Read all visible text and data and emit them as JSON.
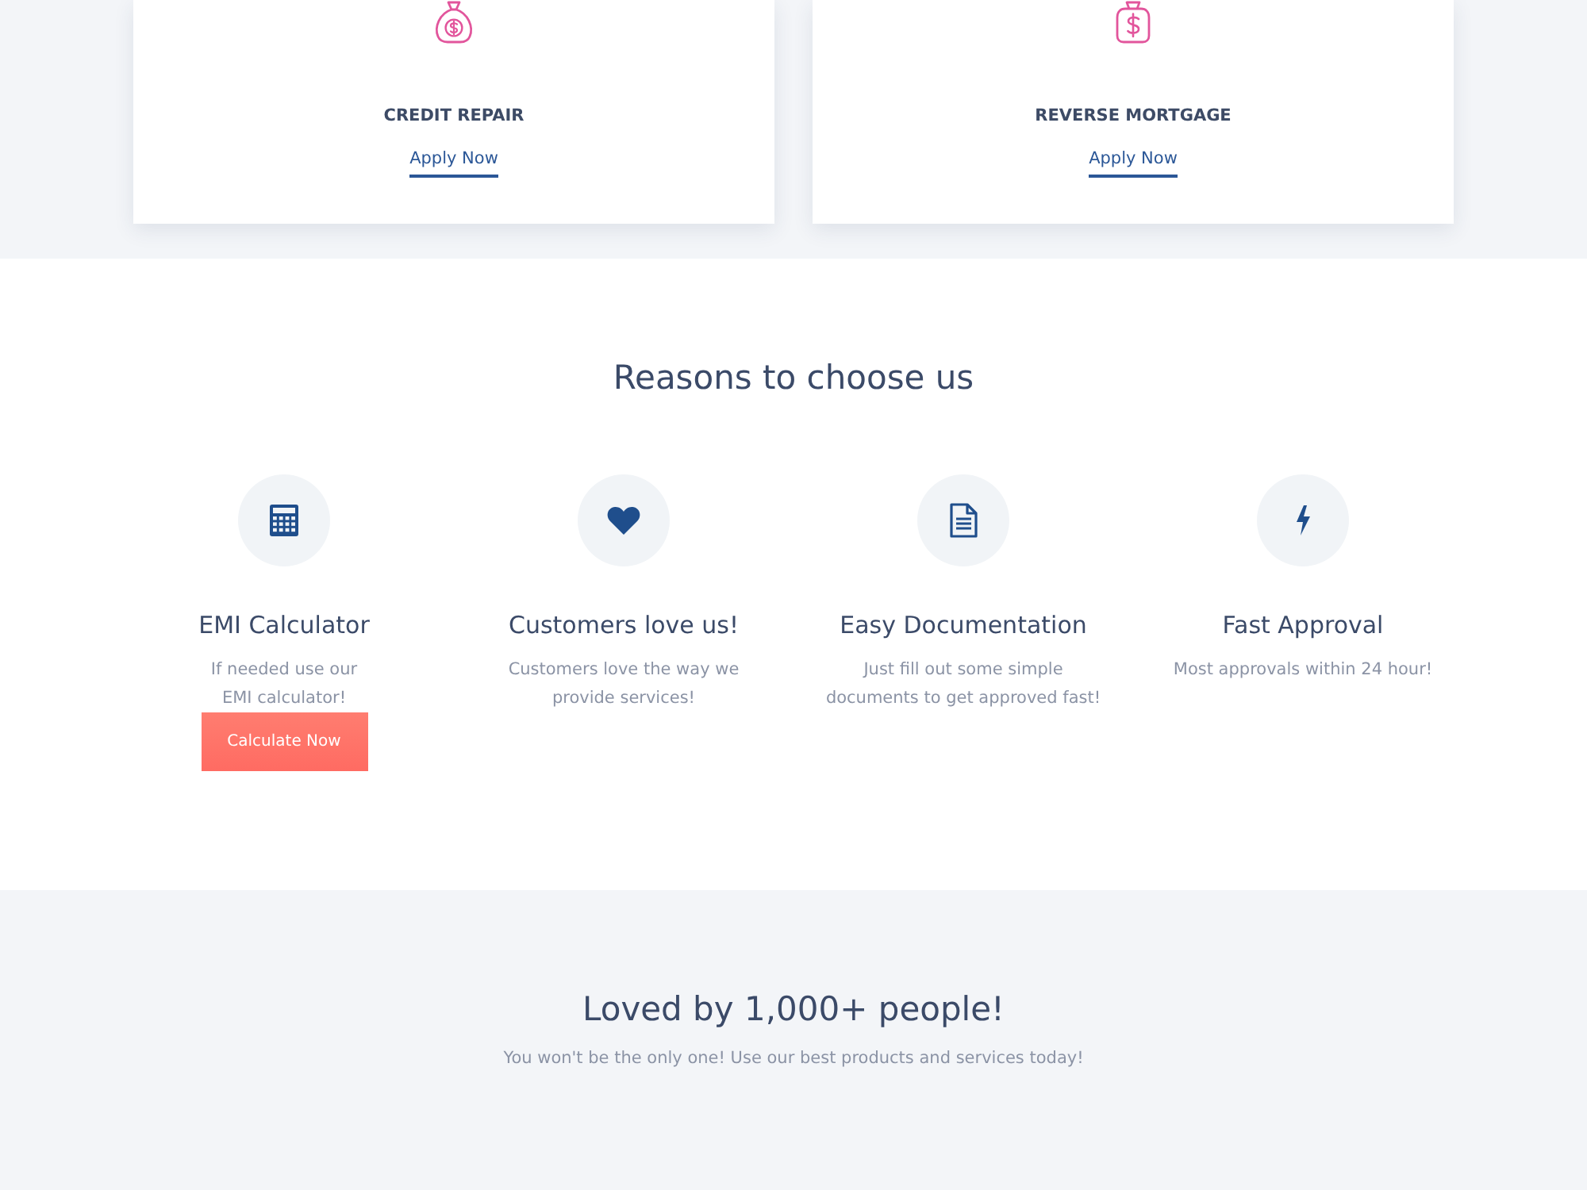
{
  "services": [
    {
      "title": "CREDIT REPAIR",
      "link": "Apply Now"
    },
    {
      "title": "REVERSE MORTGAGE",
      "link": "Apply Now"
    }
  ],
  "reasons": {
    "heading": "Reasons to choose us",
    "features": [
      {
        "title": "EMI Calculator",
        "description": "If needed use our\nEMI calculator!",
        "button": "Calculate Now"
      },
      {
        "title": "Customers love us!",
        "description": "Customers love the way we\nprovide services!"
      },
      {
        "title": "Easy Documentation",
        "description": "Just fill out some simple\ndocuments to get approved fast!"
      },
      {
        "title": "Fast Approval",
        "description": "Most approvals within 24 hour!"
      }
    ]
  },
  "testimonials": {
    "heading": "Loved by 1,000+ people!",
    "subtitle": "You won't be the only one! Use our best products and services today!"
  }
}
